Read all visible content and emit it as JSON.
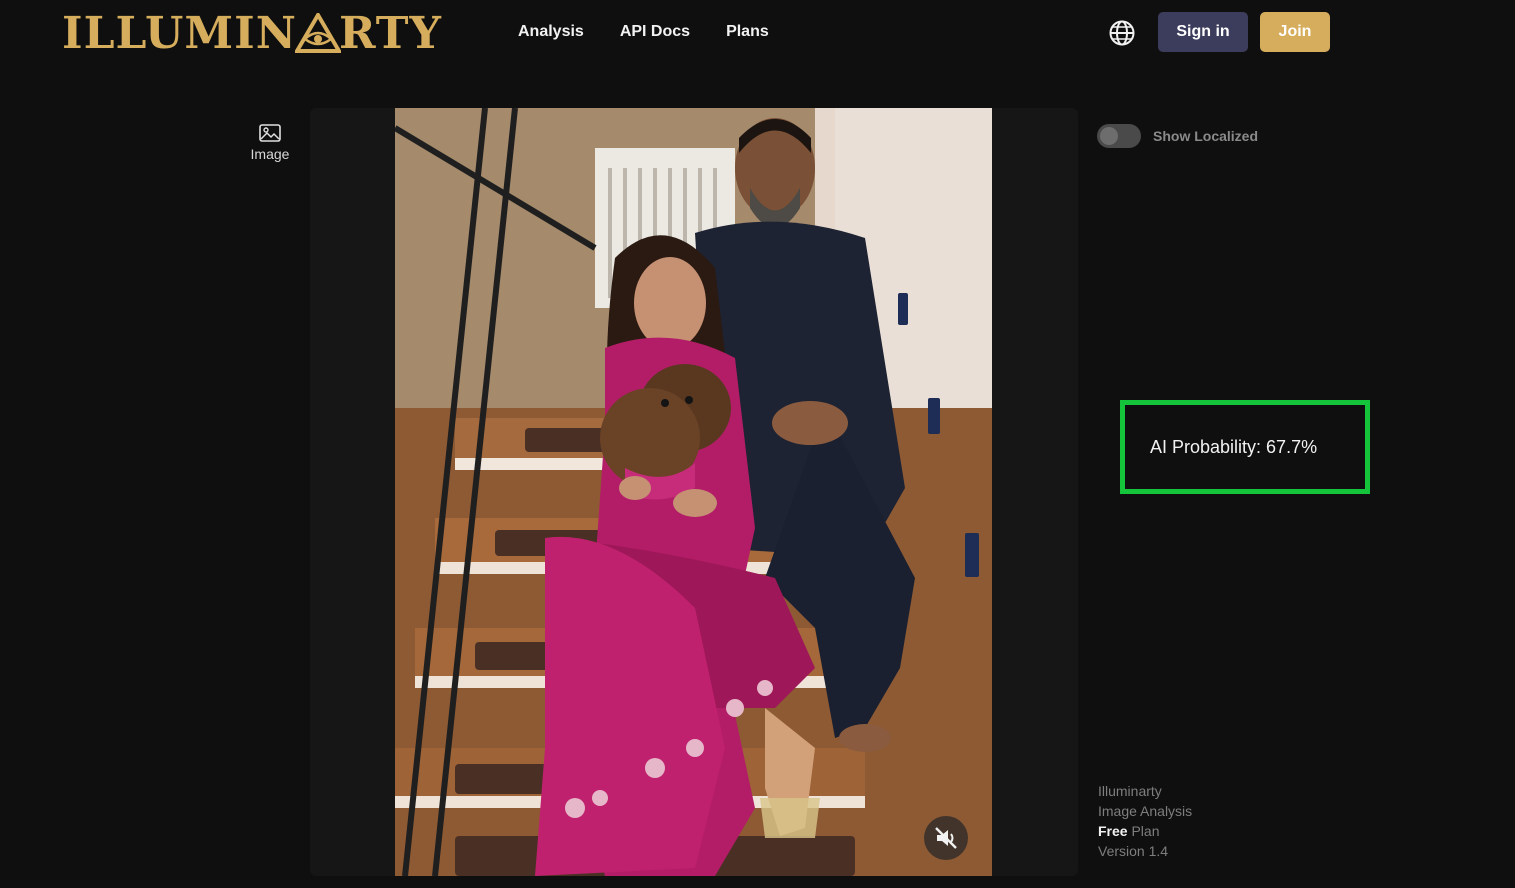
{
  "header": {
    "logo_text_left": "ILLUMIN",
    "logo_text_right": "RTY",
    "nav": [
      "Analysis",
      "API Docs",
      "Plans"
    ],
    "sign_in_label": "Sign in",
    "join_label": "Join"
  },
  "sidebar": {
    "tool_label": "Image"
  },
  "controls": {
    "toggle_label": "Show Localized",
    "toggle_on": false
  },
  "result": {
    "label": "AI Probability: 67.7%"
  },
  "footer": {
    "app_name": "Illuminarty",
    "product": "Image Analysis",
    "plan_bold": "Free",
    "plan_suffix": " Plan",
    "version": "Version 1.4"
  },
  "colors": {
    "brand_gold": "#d6ad5c",
    "signin_bg": "#3c3d5c",
    "highlight_green": "#14c43a",
    "background": "#0f0f0f"
  },
  "icons": {
    "globe": "globe-icon",
    "image": "image-icon",
    "mute": "mute-icon"
  }
}
